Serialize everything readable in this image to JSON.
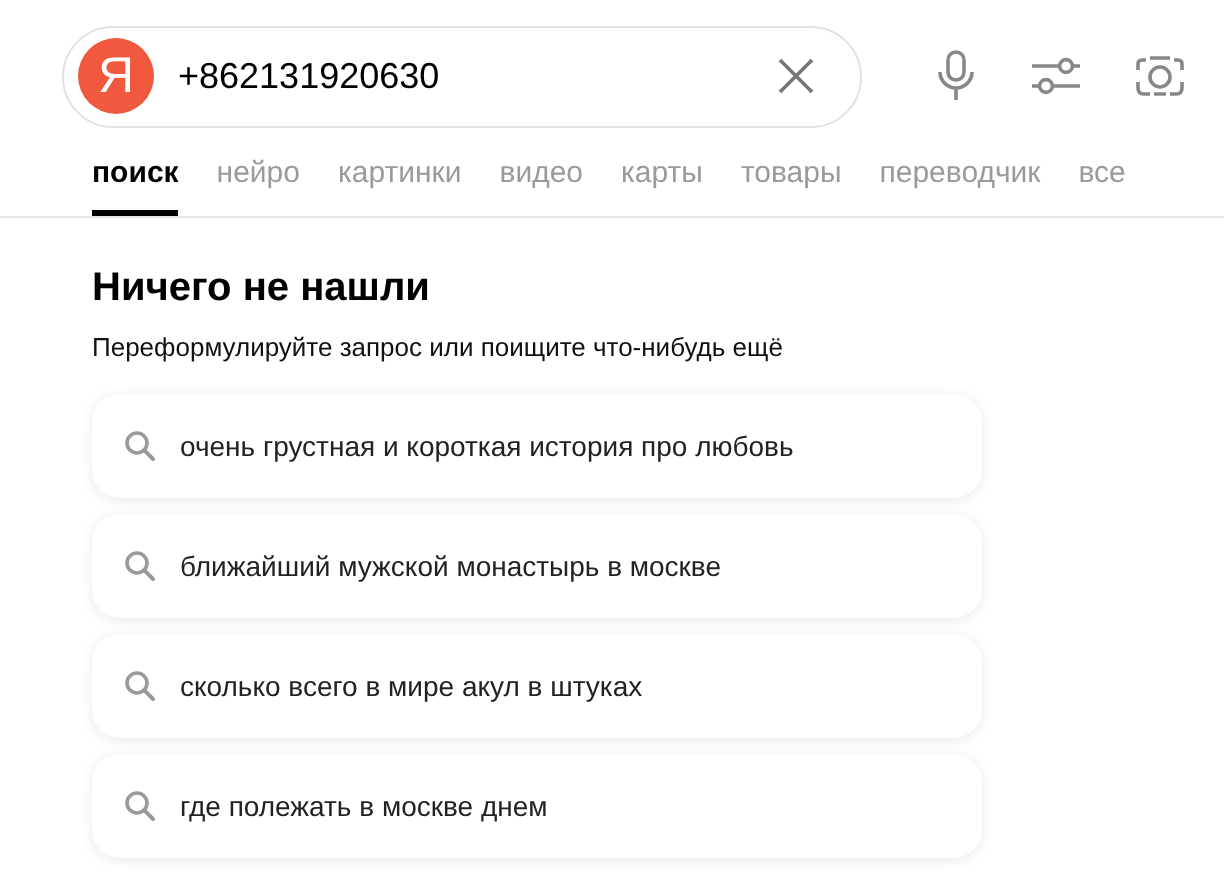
{
  "search": {
    "logo": "Я",
    "value": "+862131920630"
  },
  "tabs": [
    {
      "label": "поиск",
      "selected": true
    },
    {
      "label": "нейро",
      "selected": false
    },
    {
      "label": "картинки",
      "selected": false
    },
    {
      "label": "видео",
      "selected": false
    },
    {
      "label": "карты",
      "selected": false
    },
    {
      "label": "товары",
      "selected": false
    },
    {
      "label": "переводчик",
      "selected": false
    },
    {
      "label": "все",
      "selected": false
    }
  ],
  "empty_state": {
    "title": "Ничего не нашли",
    "subtitle": "Переформулируйте запрос или поищите что-нибудь ещё"
  },
  "suggestions": [
    "очень грустная и короткая история про любовь",
    "ближайший мужской монастырь в москве",
    "сколько всего в мире акул в штуках",
    "где полежать в москве днем"
  ]
}
